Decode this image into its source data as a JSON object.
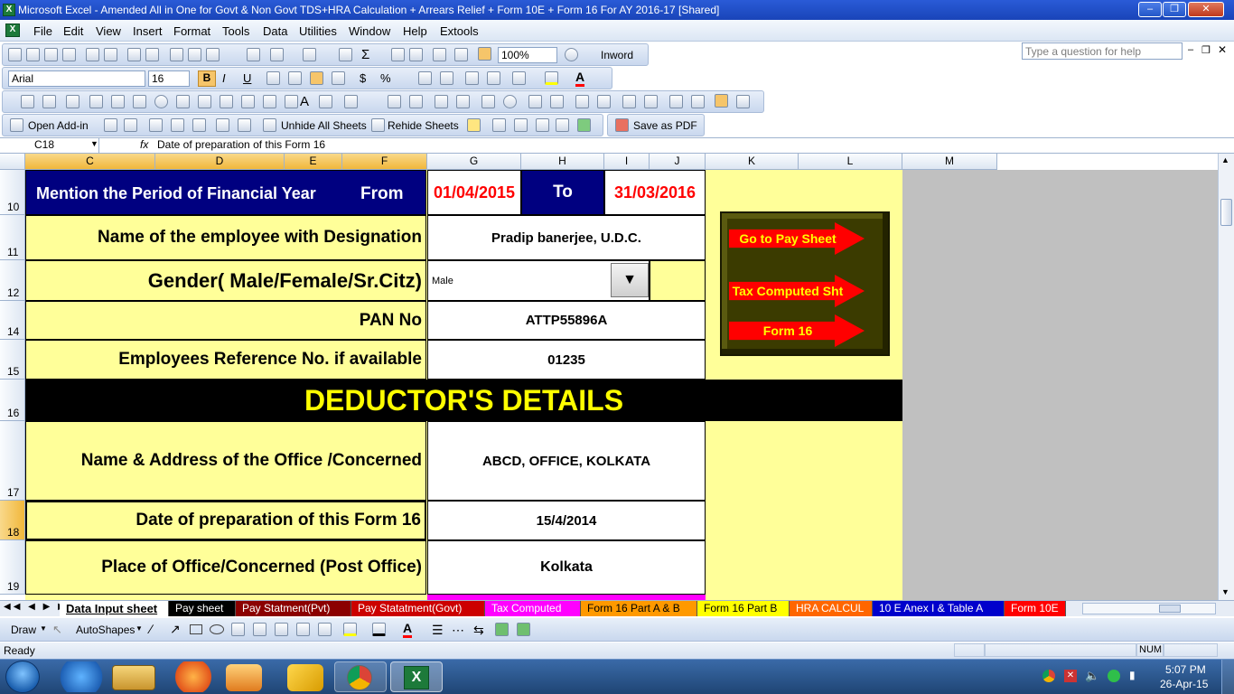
{
  "window": {
    "title": "Microsoft Excel - Amended All in One for Govt & Non Govt TDS+HRA Calculation + Arrears Relief + Form 10E + Form 16 For AY 2016-17  [Shared]"
  },
  "menu": [
    "File",
    "Edit",
    "View",
    "Insert",
    "Format",
    "Tools",
    "Data",
    "Utilities",
    "Window",
    "Help",
    "Extools"
  ],
  "help_placeholder": "Type a question for help",
  "toolbar": {
    "zoom": "100%",
    "inword": "Inword",
    "font": "Arial",
    "font_size": "16"
  },
  "addin_bar": {
    "open_addin": "Open Add-in",
    "unhide": "Unhide All Sheets",
    "rehide": "Rehide Sheets",
    "save_pdf": "Save as PDF"
  },
  "formula_bar": {
    "name_box": "C18",
    "fx": "fx",
    "content": "Date of preparation of this Form 16"
  },
  "columns": [
    "C",
    "D",
    "E",
    "F",
    "G",
    "H",
    "I",
    "J",
    "K",
    "L",
    "M"
  ],
  "rows": [
    "10",
    "11",
    "12",
    "14",
    "15",
    "16",
    "17",
    "18",
    "19"
  ],
  "sheet": {
    "period_label": "Mention the Period of Financial Year",
    "from_label": "From",
    "from_date": "01/04/2015",
    "to_label": "To",
    "to_date": "31/03/2016",
    "name_label": "Name of the employee with Designation",
    "name_value": "Pradip banerjee, U.D.C.",
    "gender_label": "Gender( Male/Female/Sr.Citz)",
    "gender_value": "Male",
    "pan_label": "PAN No",
    "pan_value": "ATTP55896A",
    "ref_label": "Employees Reference No. if available",
    "ref_value": "01235",
    "deductor_heading": "DEDUCTOR'S DETAILS",
    "office_label": "Name  & Address of the Office /Concerned",
    "office_value": "ABCD, OFFICE, KOLKATA",
    "date_label": "Date of preparation of this Form 16",
    "date_value": "15/4/2014",
    "place_label": "Place of Office/Concerned (Post Office)",
    "place_value": "Kolkata"
  },
  "nav_buttons": [
    "Go to Pay Sheet",
    "Tax Computed Sht",
    "Form 16"
  ],
  "sheet_tabs": [
    {
      "label": "Data Input sheet",
      "color": "#ffffff",
      "text": "#000000"
    },
    {
      "label": "Pay sheet",
      "color": "#000000",
      "text": "#ffffff"
    },
    {
      "label": "Pay Statment(Pvt)",
      "color": "#8b0000",
      "text": "#ffffff"
    },
    {
      "label": "Pay Statatment(Govt)",
      "color": "#cc0000",
      "text": "#ffffff"
    },
    {
      "label": "Tax Computed",
      "color": "#ff00ff",
      "text": "#ffffff"
    },
    {
      "label": "Form 16 Part A & B",
      "color": "#ff9900",
      "text": "#000000"
    },
    {
      "label": "Form 16 Part B",
      "color": "#ffff00",
      "text": "#000000"
    },
    {
      "label": "HRA CALCUL",
      "color": "#ff6600",
      "text": "#ffffff"
    },
    {
      "label": "10 E Anex I & Table A",
      "color": "#0000cc",
      "text": "#ffffff"
    },
    {
      "label": "Form 10E",
      "color": "#ff0000",
      "text": "#ffffff"
    }
  ],
  "drawbar": {
    "draw": "Draw",
    "autoshapes": "AutoShapes"
  },
  "status": {
    "ready": "Ready",
    "num": "NUM"
  },
  "clock": {
    "time": "5:07 PM",
    "date": "26-Apr-15"
  },
  "colors": {
    "navy": "#000080",
    "yellow": "#ffff99",
    "red": "#ff0000",
    "gray": "#c0c0c0"
  }
}
